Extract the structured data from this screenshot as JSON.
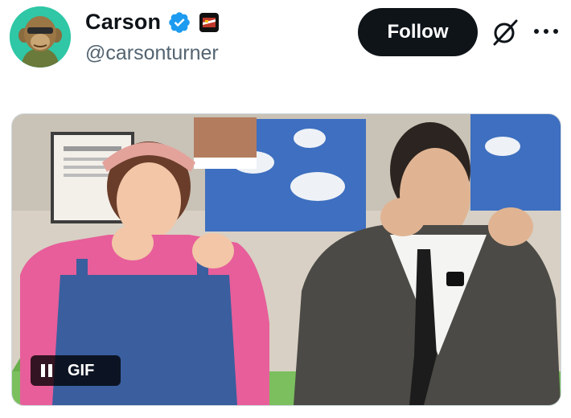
{
  "user": {
    "display_name": "Carson",
    "handle": "@carsonturner"
  },
  "actions": {
    "follow_label": "Follow"
  },
  "media": {
    "badge_label": "GIF"
  },
  "colors": {
    "verified": "#1d9bf0",
    "follow_bg": "#0f1419",
    "avatar_bg": "#2fc7a6"
  },
  "icons": [
    "verified-badge-icon",
    "affiliation-flag-icon",
    "grok-icon",
    "more-options-icon",
    "pause-icon"
  ]
}
